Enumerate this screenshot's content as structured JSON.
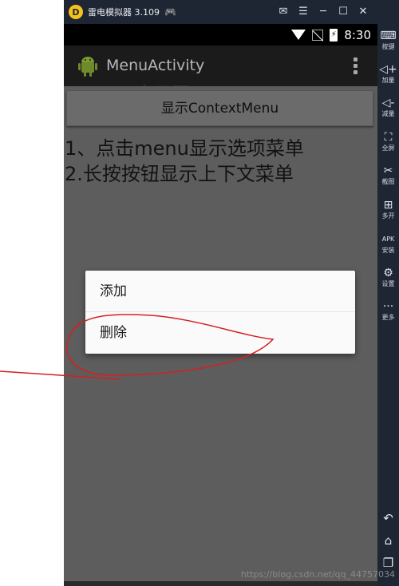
{
  "emulator": {
    "title": "雷电模拟器 3.109",
    "controls": [
      "✉",
      "☰",
      "─",
      "☐",
      "✕"
    ],
    "sidebar": [
      {
        "icon": "⌨",
        "label": "按键",
        "name": "keyboard-icon"
      },
      {
        "icon": "◁+",
        "label": "加量",
        "name": "volume-up-icon"
      },
      {
        "icon": "◁-",
        "label": "减量",
        "name": "volume-down-icon"
      },
      {
        "icon": "⛶",
        "label": "全屏",
        "name": "fullscreen-icon"
      },
      {
        "icon": "✂",
        "label": "截图",
        "name": "screenshot-icon"
      },
      {
        "icon": "⊞",
        "label": "多开",
        "name": "multi-instance-icon"
      },
      {
        "icon": "APK",
        "label": "安装",
        "name": "install-apk-icon"
      },
      {
        "icon": "⚙",
        "label": "设置",
        "name": "settings-icon"
      },
      {
        "icon": "···",
        "label": "更多",
        "name": "more-icon"
      }
    ],
    "nav": [
      {
        "icon": "↶",
        "name": "back-icon"
      },
      {
        "icon": "⌂",
        "name": "home-icon"
      },
      {
        "icon": "❐",
        "name": "recent-apps-icon"
      }
    ]
  },
  "statusbar": {
    "time": "8:30"
  },
  "actionbar": {
    "title": "MenuActivity"
  },
  "watermark": "吉云网",
  "main": {
    "button_label": "显示ContextMenu",
    "line1": "1、点击menu显示选项菜单",
    "line2": "2.长按按钮显示上下文菜单"
  },
  "context_menu": {
    "items": [
      "添加",
      "删除"
    ]
  },
  "footer_url": "https://blog.csdn.net/qq_44757034",
  "colors": {
    "emulator_chrome": "#1f2633",
    "dim_overlay": "#5d5d5d",
    "annotation_red": "#d42020",
    "menu_bg": "#fafafa"
  }
}
